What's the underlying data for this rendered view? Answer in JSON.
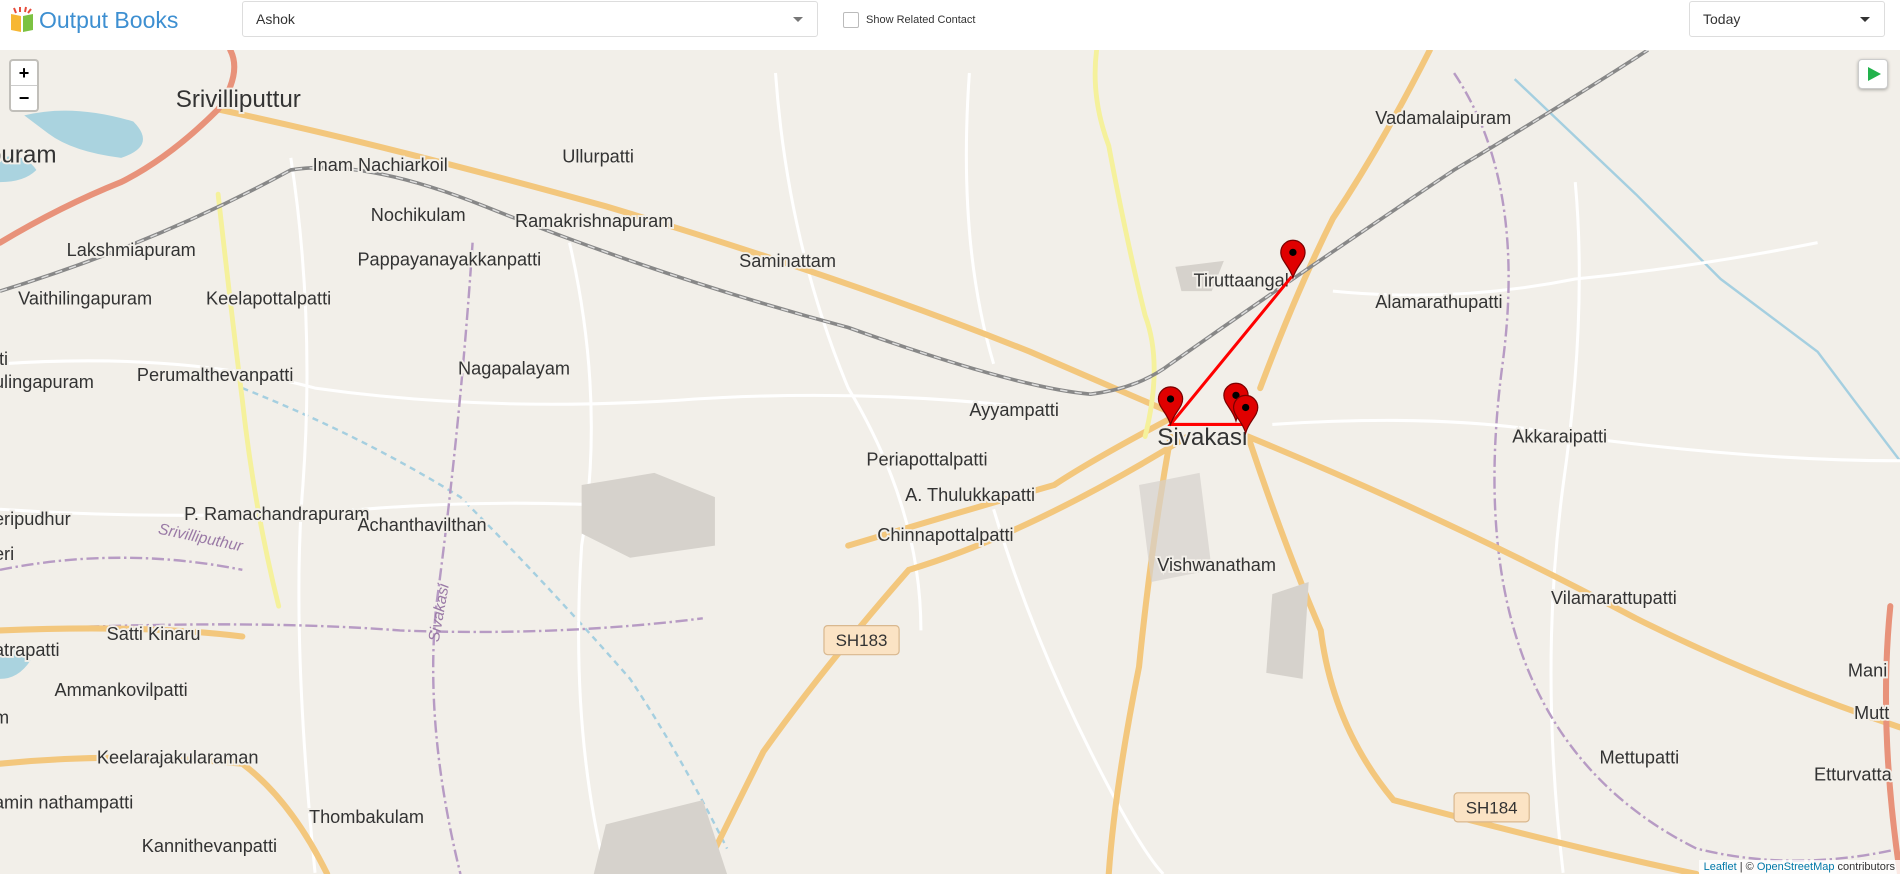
{
  "header": {
    "logo_text": "Output Books",
    "contact_select": {
      "value": "Ashok"
    },
    "show_related_contact": {
      "label": "Show Related Contact",
      "checked": false
    },
    "date_select": {
      "value": "Today"
    }
  },
  "map": {
    "zoom_in": "+",
    "zoom_out": "−",
    "play_icon": "play-icon",
    "marker_color": "#e00000",
    "route_color": "#ff0000",
    "markers_count": 4,
    "places": [
      {
        "name": "Srivilliputtur",
        "major": true
      },
      {
        "name": "puram",
        "major": true
      },
      {
        "name": "Inam Nachiarkoil"
      },
      {
        "name": "Ullurpatti"
      },
      {
        "name": "Nochikulam"
      },
      {
        "name": "Ramakrishnapuram"
      },
      {
        "name": "Lakshmiapuram"
      },
      {
        "name": "Pappayanayakkanpatti"
      },
      {
        "name": "Saminattam"
      },
      {
        "name": "Vaithilingapuram"
      },
      {
        "name": "Keelapottalpatti"
      },
      {
        "name": "Nagapalayam"
      },
      {
        "name": "Perumalthevanpatti"
      },
      {
        "name": "ulingapuram"
      },
      {
        "name": "tti"
      },
      {
        "name": "Ayyampatti"
      },
      {
        "name": "Sivakasi",
        "major": true
      },
      {
        "name": "Tiruttaangal"
      },
      {
        "name": "Alamarathupatti"
      },
      {
        "name": "Vadamalaipuram"
      },
      {
        "name": "Akkaraipatti"
      },
      {
        "name": "Periapottalpatti"
      },
      {
        "name": "A. Thulukkapatti"
      },
      {
        "name": "Chinnapottalpatti"
      },
      {
        "name": "P. Ramachandrapuram"
      },
      {
        "name": "Achanthavilthan"
      },
      {
        "name": "eripudhur"
      },
      {
        "name": "eri"
      },
      {
        "name": "Vishwanatham"
      },
      {
        "name": "Vilamarattupatti"
      },
      {
        "name": "Satti Kinaru"
      },
      {
        "name": "atrapatti"
      },
      {
        "name": "Ammankovilpatti"
      },
      {
        "name": "Keelarajakularaman"
      },
      {
        "name": "amin nathampatti"
      },
      {
        "name": "Thombakulam"
      },
      {
        "name": "Kannithevanpatti"
      },
      {
        "name": "Mettupatti"
      },
      {
        "name": "Etturvatta"
      },
      {
        "name": "Mani"
      },
      {
        "name": "Mutt"
      },
      {
        "name": "m"
      },
      {
        "name": "tti"
      }
    ],
    "shields": [
      "SH183",
      "SH184"
    ],
    "waterway_labels": [
      "Srivilliputhur",
      "Sivakasi"
    ],
    "attribution": {
      "leaflet": "Leaflet",
      "sep": " | © ",
      "osm": "OpenStreetMap",
      "suffix": " contributors"
    }
  }
}
